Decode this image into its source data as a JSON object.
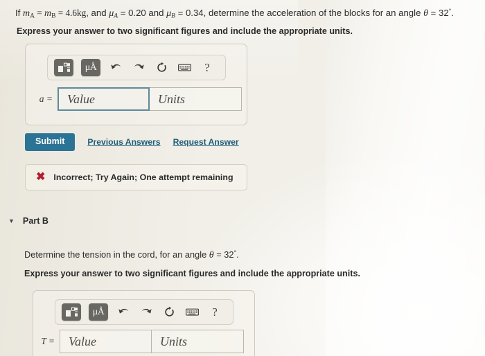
{
  "problem": {
    "statement_prefix": "If ",
    "mass_a": "m",
    "mass_a_sub": "A",
    "eq1": " = ",
    "mass_b": "m",
    "mass_b_sub": "B",
    "eq2": " = ",
    "mass_value": "4.6kg",
    "conj1": ", and ",
    "mu_a": "μ",
    "mu_a_sub": "A",
    "mu_a_value": " = 0.20",
    "conj2": " and ",
    "mu_b": "μ",
    "mu_b_sub": "B",
    "mu_b_value": " = 0.34",
    "tail": ", determine the acceleration of the blocks for an angle ",
    "theta": "θ",
    "theta_value": " = 32",
    "degree": "°",
    "period": ".",
    "full_text": "If m_A = m_B = 4.6kg, and μ_A = 0.20 and μ_B = 0.34, determine the acceleration of the blocks for an angle θ = 32 °.",
    "instruction": "Express your answer to two significant figures and include the appropriate units."
  },
  "toolbar": {
    "template_icon": "math-template-icon",
    "units_icon": "μÅ",
    "units_icon_name": "units-micro-angstrom-icon",
    "undo_icon": "undo-arrow-icon",
    "redo_icon": "redo-arrow-icon",
    "reset_icon": "reset-circular-arrow-icon",
    "keyboard_icon": "keyboard-icon",
    "help_label": "?"
  },
  "part_a": {
    "answer_label": "a =",
    "value_placeholder": "Value",
    "units_placeholder": "Units",
    "value_text": "Value",
    "units_text": "Units",
    "value_focused": true,
    "submit_label": "Submit",
    "previous_answers_label": "Previous Answers",
    "request_answer_label": "Request Answer",
    "feedback_mark": "✖",
    "feedback_text": "Incorrect; Try Again; One attempt remaining"
  },
  "part_b": {
    "toggle_icon": "▼",
    "title": "Part B",
    "question_prefix": "Determine the tension in the cord, for an angle ",
    "theta": "θ",
    "theta_value": " = 32",
    "degree": "°",
    "period": ".",
    "question_full": "Determine the tension in the cord, for an angle θ = 32 °.",
    "instruction": "Express your answer to two significant figures and include the appropriate units.",
    "answer_label": "T =",
    "value_text": "Value",
    "units_text": "Units",
    "value_placeholder": "Value",
    "units_placeholder": "Units"
  },
  "colors": {
    "page_background": "#f1efe8",
    "submit_button": "#2c7495",
    "link": "#1f5d7a",
    "error_mark": "#b4202d",
    "focus_border": "#5f8a99",
    "toolbar_button": "#696761"
  }
}
